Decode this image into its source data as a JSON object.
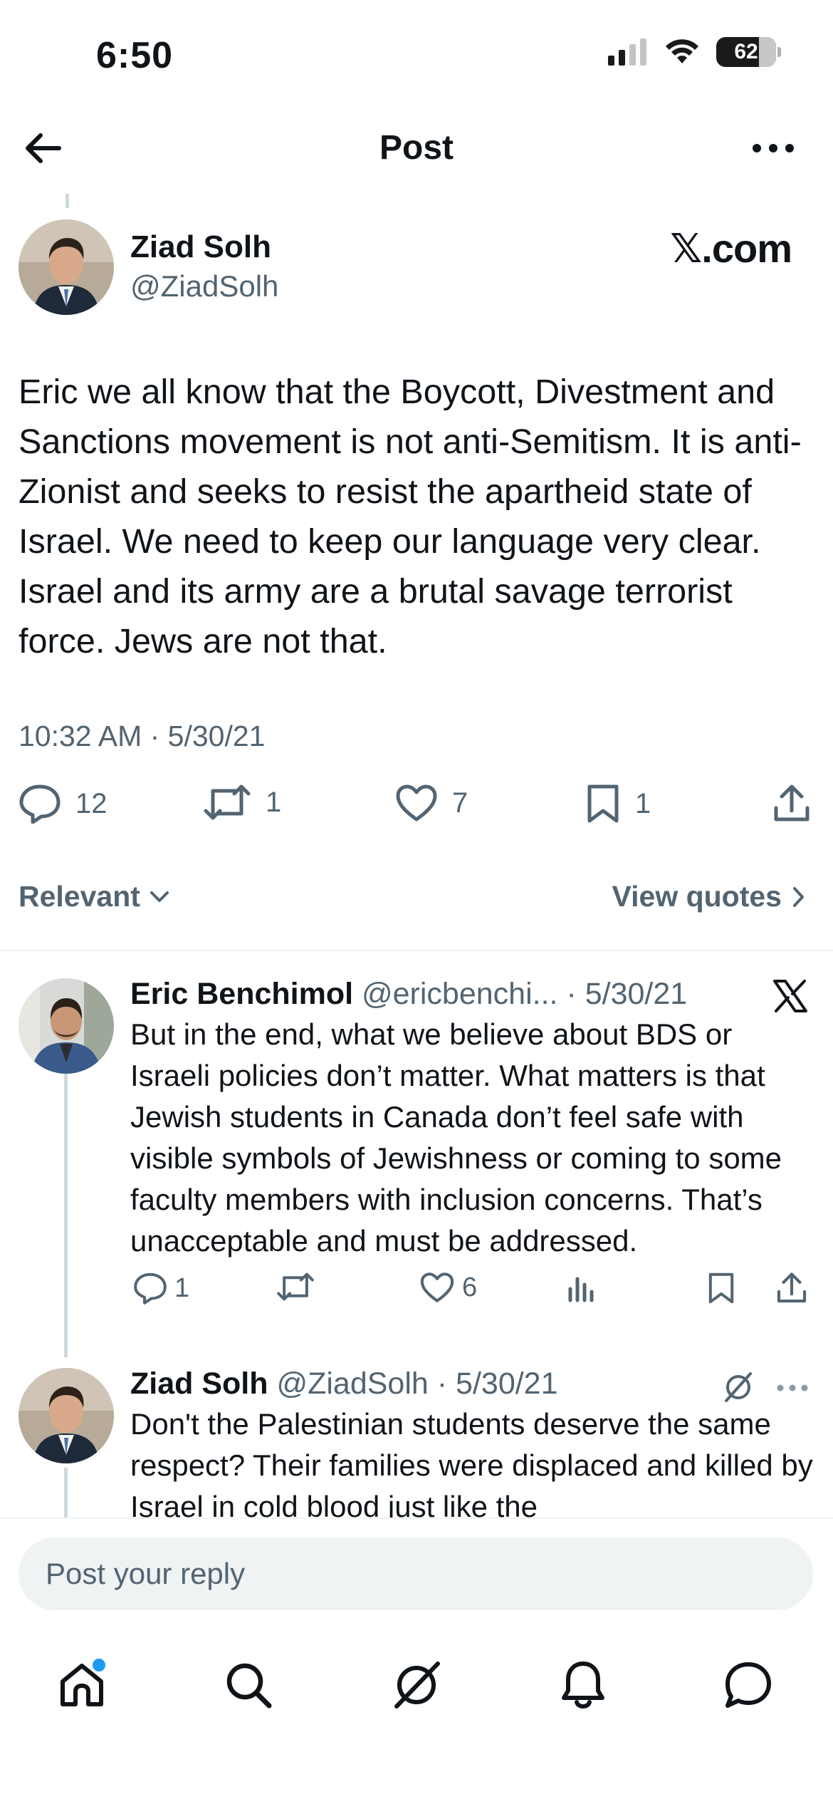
{
  "status_bar": {
    "time": "6:50",
    "battery": "62"
  },
  "header": {
    "title": "Post"
  },
  "post": {
    "author_name": "Ziad Solh",
    "author_handle": "@ZiadSolh",
    "source_label": "𝕏.com",
    "text": "Eric we all know that the Boycott, Divestment and Sanctions movement is not anti-Semitism. It is anti-Zionist and seeks to resist the apartheid state of Israel. We need to keep our language very clear. Israel and its army are a brutal savage terrorist force. Jews are not that.",
    "timestamp": "10:32 AM · 5/30/21",
    "replies": "12",
    "reposts": "1",
    "likes": "7",
    "bookmarks": "1"
  },
  "sort": {
    "label": "Relevant",
    "quotes_label": "View quotes"
  },
  "replies": [
    {
      "name": "Eric Benchimol",
      "handle": "@ericbenchi...",
      "date": "· 5/30/21",
      "text": "But in the end, what we believe about BDS or Israeli policies don’t matter. What matters is that Jewish students in Canada don’t feel safe with visible symbols of Jewishness or coming to some faculty members with inclusion concerns. That’s unacceptable and must be addressed.",
      "replies": "1",
      "reposts": "",
      "likes": "6",
      "badge_icon": "x-logo-icon"
    },
    {
      "name": "Ziad Solh",
      "handle": "@ZiadSolh",
      "date": "· 5/30/21",
      "text": "Don't the Palestinian students deserve the same respect? Their families were displaced and killed by Israel in cold blood just like the",
      "badge_icon": "grok-icon"
    }
  ],
  "composer": {
    "placeholder": "Post your reply"
  },
  "tab_bar": {
    "icons": [
      "home-icon",
      "search-icon",
      "grok-icon",
      "notifications-icon",
      "messages-icon"
    ],
    "accent": "#1d9bf0"
  },
  "colors": {
    "text": "#0f1419",
    "secondary": "#536471",
    "divider": "#eff3f4"
  }
}
